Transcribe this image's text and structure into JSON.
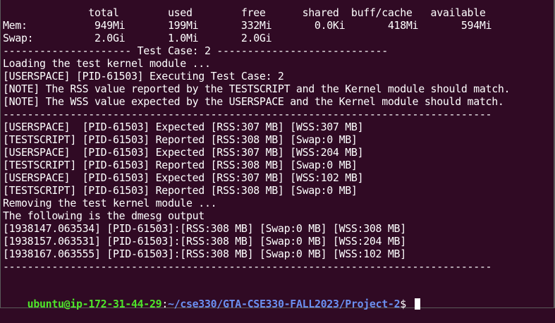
{
  "terminal": {
    "lines": [
      "              total        used        free      shared  buff/cache   available",
      "Mem:           949Mi       199Mi       332Mi       0.0Ki       418Mi       594Mi",
      "Swap:          2.0Gi       1.0Mi       2.0Gi",
      "--------------------- Test Case: 2 ----------------------------",
      "Loading the test kernel module ...",
      "[USERSPACE] [PID-61503] Executing Test Case: 2",
      "[NOTE] The RSS value reported by the TESTSCRIPT and the Kernel module should match.",
      "[NOTE] The WSS value expected by the USERSPACE and the Kernel module should match.",
      "--------------------------------------------------------------------------------",
      "[USERSPACE]  [PID-61503] Expected [RSS:307 MB] [WSS:307 MB]",
      "[TESTSCRIPT] [PID-61503] Reported [RSS:308 MB] [Swap:0 MB]",
      "[USERSPACE]  [PID-61503] Expected [RSS:307 MB] [WSS:204 MB]",
      "[TESTSCRIPT] [PID-61503] Reported [RSS:308 MB] [Swap:0 MB]",
      "[USERSPACE]  [PID-61503] Expected [RSS:307 MB] [WSS:102 MB]",
      "[TESTSCRIPT] [PID-61503] Reported [RSS:308 MB] [Swap:0 MB]",
      "Removing the test kernel module ...",
      "The following is the dmesg output",
      "[1938147.063534] [PID-61503]:[RSS:308 MB] [Swap:0 MB] [WSS:308 MB]",
      "[1938157.063531] [PID-61503]:[RSS:308 MB] [Swap:0 MB] [WSS:204 MB]",
      "[1938167.063555] [PID-61503]:[RSS:308 MB] [Swap:0 MB] [WSS:102 MB]",
      "--------------------------------------------------------------------------------",
      ""
    ],
    "prompt": {
      "user_host": "ubuntu@ip-172-31-44-29",
      "colon": ":",
      "path": "~/cse330/GTA-CSE330-FALL2023/Project-2",
      "dollar": "$ "
    },
    "colors": {
      "background": "#300a24",
      "text": "#ffffff",
      "user_host": "#4ee62a",
      "path": "#6b8ff0"
    }
  }
}
